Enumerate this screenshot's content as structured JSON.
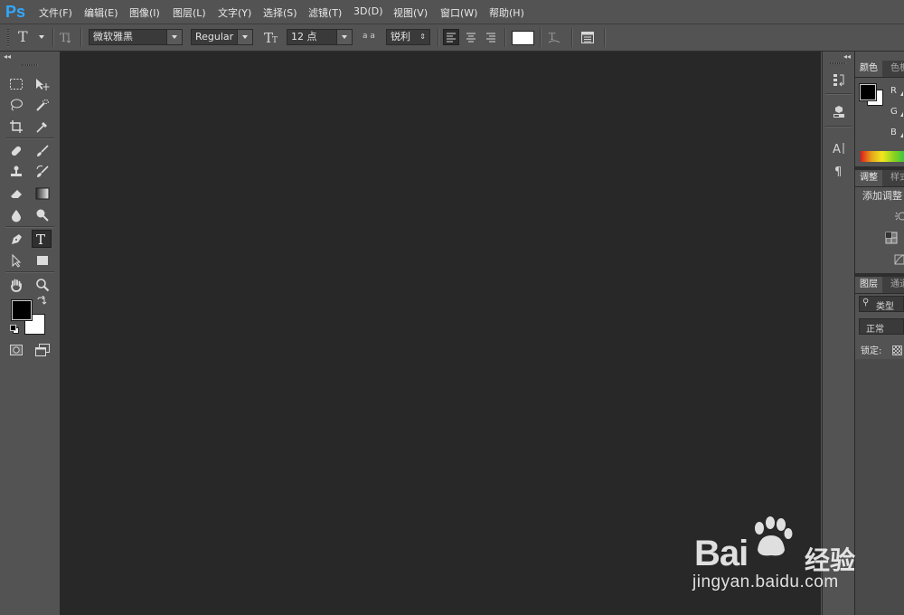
{
  "app": {
    "logo": "Ps"
  },
  "menu": [
    "文件(F)",
    "编辑(E)",
    "图像(I)",
    "图层(L)",
    "文字(Y)",
    "选择(S)",
    "滤镜(T)",
    "3D(D)",
    "视图(V)",
    "窗口(W)",
    "帮助(H)"
  ],
  "options_bar": {
    "tool_glyph": "T",
    "font_family": "微软雅黑",
    "font_style": "Regular",
    "font_size": "12 点",
    "aa_icon": "a a",
    "antialias": "锐利",
    "text_color": "#ffffff"
  },
  "tools": {
    "left": [
      "marquee-tool",
      "lasso-tool",
      "crop-tool",
      "healing-brush-tool",
      "clone-stamp-tool",
      "eraser-tool",
      "blur-tool",
      "pen-tool",
      "path-selection-tool",
      "hand-tool"
    ],
    "right": [
      "move-tool",
      "quick-selection-tool",
      "eyedropper-tool",
      "brush-tool",
      "history-brush-tool",
      "gradient-tool",
      "dodge-tool",
      "type-tool",
      "rectangle-tool",
      "zoom-tool"
    ],
    "active": "type-tool",
    "foreground_color": "#000000",
    "background_color": "#ffffff"
  },
  "icon_strip": [
    "history-icon",
    "3d-icon",
    "character-icon",
    "paragraph-icon"
  ],
  "panels": {
    "color": {
      "tabs": [
        "颜色",
        "色板"
      ],
      "channels": [
        "R",
        "G",
        "B"
      ]
    },
    "adjustments": {
      "tabs": [
        "调整",
        "样式"
      ],
      "title": "添加调整"
    },
    "layers": {
      "tabs": [
        "图层",
        "通道"
      ],
      "filter_label": "类型",
      "blend_mode": "正常",
      "lock_label": "锁定:"
    }
  },
  "watermark": {
    "brand": "Bai",
    "suffix": "经验",
    "url": "jingyan.baidu.com"
  },
  "colors": {
    "accent": "#31a8ff",
    "ui_bg": "#535353",
    "canvas_bg": "#282828"
  }
}
